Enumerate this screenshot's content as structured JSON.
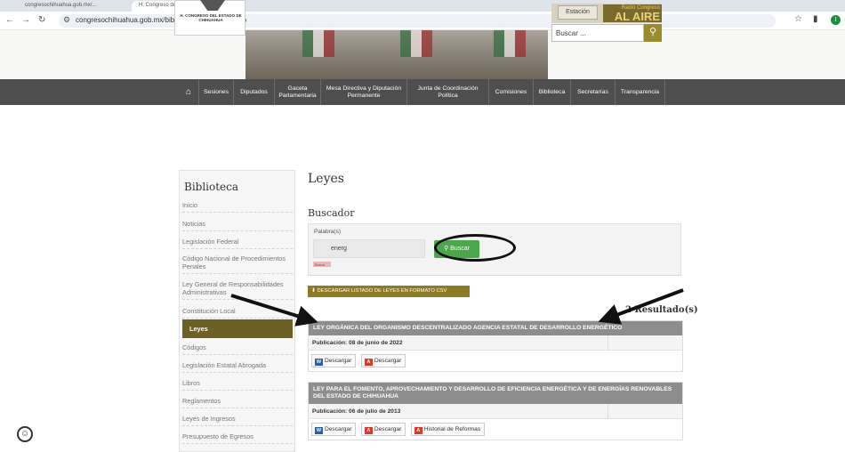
{
  "browser": {
    "tabs": [
      "congresochihuahua.gob.mx/...",
      "H. Congreso del Estado de Ch..."
    ],
    "url": "congresochihuahua.gob.mx/biblioteca/leyes/index.php",
    "profile_initial": "I"
  },
  "header": {
    "logo_text": "H. CONGRESO DEL ESTADO DE CHIHUAHUA",
    "radio_wave_text": "Estación",
    "radio_small": "Radio Congreso",
    "radio_big": "AL AIRE",
    "search_placeholder": "Buscar ..."
  },
  "nav": {
    "items": [
      {
        "label": "Sesiones"
      },
      {
        "label": "Diputados"
      },
      {
        "label": "Gaceta Parlamentaria"
      },
      {
        "label": "Mesa Directiva y Diputación Permanente"
      },
      {
        "label": "Junta de Coordinación Política"
      },
      {
        "label": "Comisiones"
      },
      {
        "label": "Biblioteca"
      },
      {
        "label": "Secretarías"
      },
      {
        "label": "Transparencia"
      }
    ]
  },
  "sidebar": {
    "title": "Biblioteca",
    "items": [
      "Inicio",
      "Noticias",
      "Legislación Federal",
      "Código Nacional de Procedimientos Penales",
      "Ley General de Responsabilidades Administrativas",
      "Constitución Local",
      "Leyes",
      "Códigos",
      "Legislación Estatal Abrogada",
      "Libros",
      "Reglamentos",
      "Leyes de Ingresos",
      "Presupuesto de Egresos"
    ],
    "active_index": 6
  },
  "main": {
    "title": "Leyes",
    "buscador_title": "Buscador",
    "field_label": "Palabra(s)",
    "field_value": "energ",
    "hint": "Borrar",
    "buscar_label": "Buscar",
    "csv_label": "DESCARGAR LISTADO DE LEYES EN FORMATO CSV",
    "results_count": "2 Resultado(s)"
  },
  "results": [
    {
      "title": "LEY ORGÁNICA DEL ORGANISMO DESCENTRALIZADO AGENCIA ESTATAL DE DESARROLLO ENERGÉTICO",
      "publication": "Publicación: 08 de junio de 2022",
      "buttons": [
        {
          "icon": "word-icon",
          "label": "Descargar"
        },
        {
          "icon": "pdf-icon",
          "label": "Descargar"
        }
      ]
    },
    {
      "title": "LEY PARA EL FOMENTO, APROVECHAMIENTO Y DESARROLLO DE EFICIENCIA ENERGÉTICA Y DE ENERGÍAS RENOVABLES DEL ESTADO DE CHIHUAHUA",
      "publication": "Publicación: 06 de julio de 2013",
      "buttons": [
        {
          "icon": "word-icon",
          "label": "Descargar"
        },
        {
          "icon": "pdf-icon",
          "label": "Descargar"
        },
        {
          "icon": "pdf-icon",
          "label": "Historial de Reformas"
        }
      ]
    }
  ],
  "colors": {
    "nav_bg": "#4e4e4e",
    "gold": "#8d7a22",
    "active_bg": "#6e6024",
    "buscar_green": "#4aa84a",
    "result_header": "#8d8d8d"
  }
}
